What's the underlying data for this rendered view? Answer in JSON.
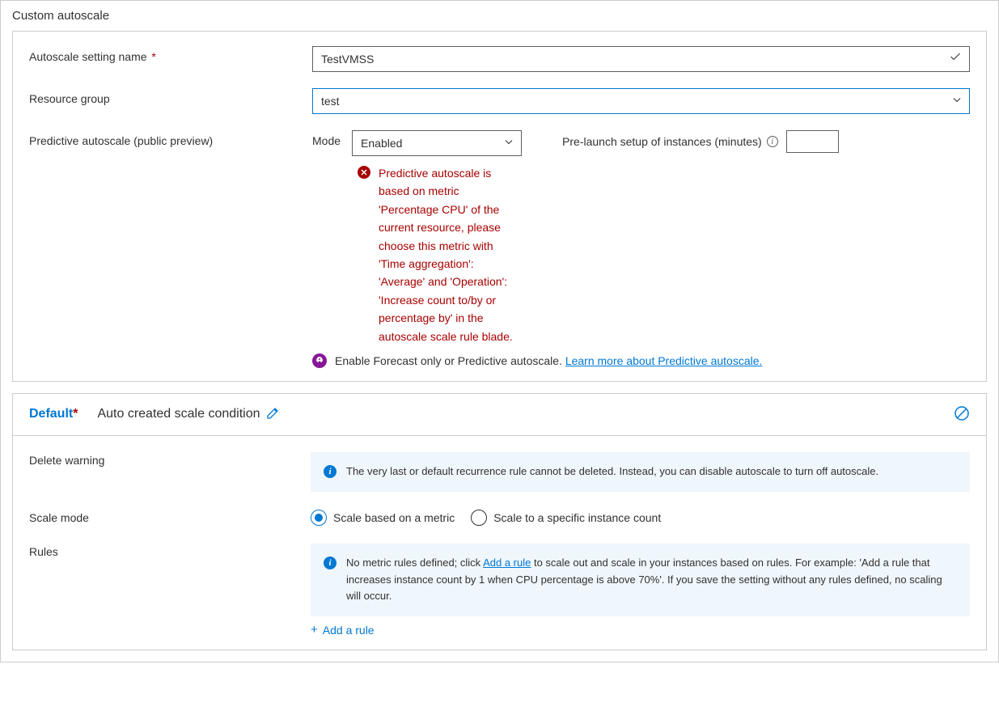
{
  "panel": {
    "title": "Custom autoscale"
  },
  "form": {
    "setting_name_label": "Autoscale setting name",
    "setting_name_value": "TestVMSS",
    "resource_group_label": "Resource group",
    "resource_group_value": "test",
    "predictive_label": "Predictive autoscale (public preview)",
    "mode_label": "Mode",
    "mode_value": "Enabled",
    "prelaunch_label": "Pre-launch setup of instances (minutes)",
    "prelaunch_value": "",
    "error_text": "Predictive autoscale is based on metric 'Percentage CPU' of the current resource, please choose this metric with 'Time aggregation': 'Average' and 'Operation': 'Increase count to/by or percentage by' in the autoscale scale rule blade.",
    "forecast_text_prefix": "Enable Forecast only or Predictive autoscale. ",
    "forecast_link": "Learn more about Predictive autoscale."
  },
  "condition": {
    "title": "Default",
    "subtitle": "Auto created scale condition",
    "delete_warning_label": "Delete warning",
    "delete_warning_text": "The very last or default recurrence rule cannot be deleted. Instead, you can disable autoscale to turn off autoscale.",
    "scale_mode_label": "Scale mode",
    "scale_mode_option1": "Scale based on a metric",
    "scale_mode_option2": "Scale to a specific instance count",
    "rules_label": "Rules",
    "rules_info_prefix": "No metric rules defined; click ",
    "rules_info_link": "Add a rule",
    "rules_info_suffix": " to scale out and scale in your instances based on rules. For example: 'Add a rule that increases instance count by 1 when CPU percentage is above 70%'. If you save the setting without any rules defined, no scaling will occur.",
    "add_rule_label": "Add a rule"
  }
}
